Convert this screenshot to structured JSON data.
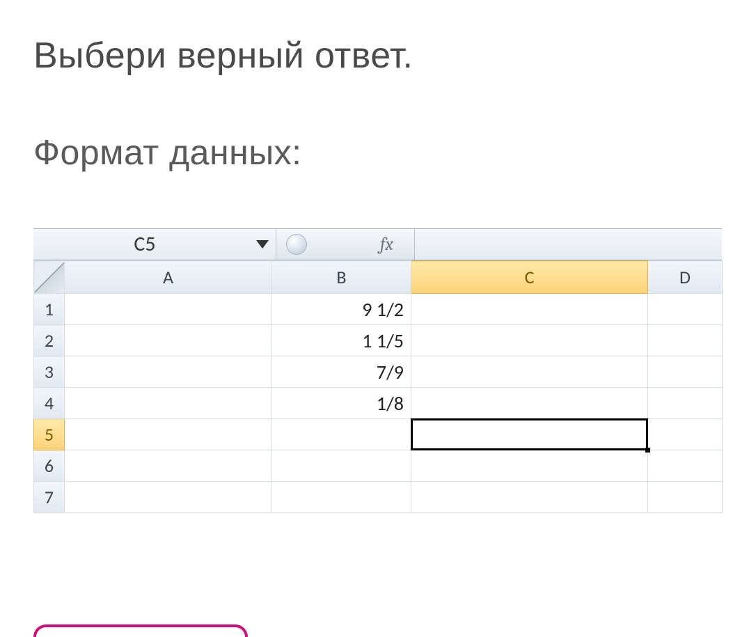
{
  "title": "Выбери верный ответ.",
  "subtitle": "Формат данных:",
  "spreadsheet": {
    "namebox": "C5",
    "fx_label": "fx",
    "columns": [
      "A",
      "B",
      "C",
      "D"
    ],
    "rows": [
      "1",
      "2",
      "3",
      "4",
      "5",
      "6",
      "7"
    ],
    "selected_col": "C",
    "selected_row": "5",
    "cells": {
      "B1": "9 1/2",
      "B2": "1 1/5",
      "B3": "7/9",
      "B4": "1/8"
    }
  }
}
